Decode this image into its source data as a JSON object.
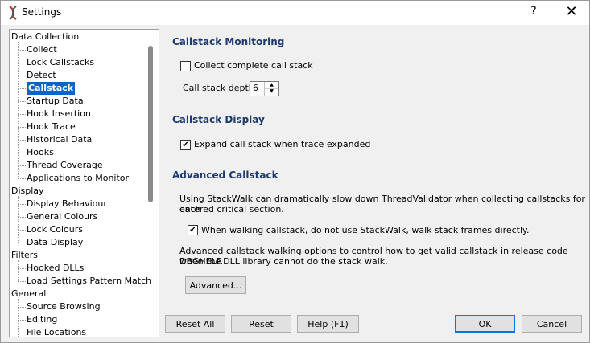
{
  "window": {
    "title": "Settings",
    "help_glyph": "?",
    "close_glyph": "✕"
  },
  "tree": {
    "items": [
      {
        "label": "Data Collection",
        "level": 0
      },
      {
        "label": "Collect",
        "level": 1
      },
      {
        "label": "Lock Callstacks",
        "level": 1
      },
      {
        "label": "Detect",
        "level": 1
      },
      {
        "label": "Callstack",
        "level": 1,
        "selected": true
      },
      {
        "label": "Startup Data",
        "level": 1
      },
      {
        "label": "Hook Insertion",
        "level": 1
      },
      {
        "label": "Hook Trace",
        "level": 1
      },
      {
        "label": "Historical Data",
        "level": 1
      },
      {
        "label": "Hooks",
        "level": 1
      },
      {
        "label": "Thread Coverage",
        "level": 1
      },
      {
        "label": "Applications to Monitor",
        "level": 1
      },
      {
        "label": "Display",
        "level": 0
      },
      {
        "label": "Display Behaviour",
        "level": 1
      },
      {
        "label": "General Colours",
        "level": 1
      },
      {
        "label": "Lock Colours",
        "level": 1
      },
      {
        "label": "Data Display",
        "level": 1
      },
      {
        "label": "Filters",
        "level": 0
      },
      {
        "label": "Hooked DLLs",
        "level": 1
      },
      {
        "label": "Load Settings Pattern Match",
        "level": 1
      },
      {
        "label": "General",
        "level": 0
      },
      {
        "label": "Source Browsing",
        "level": 1
      },
      {
        "label": "Editing",
        "level": 1
      },
      {
        "label": "File Locations",
        "level": 1
      }
    ]
  },
  "monitoring": {
    "heading": "Callstack Monitoring",
    "collect_complete_label": "Collect complete call stack",
    "collect_complete_checked": false,
    "depth_label": "Call stack depth",
    "depth_value": "6"
  },
  "display": {
    "heading": "Callstack Display",
    "expand_label": "Expand call stack when trace expanded",
    "expand_checked": true
  },
  "advanced": {
    "heading": "Advanced Callstack",
    "desc1_line1": "Using StackWalk can dramatically slow down ThreadValidator when collecting callstacks for each",
    "desc1_line2": "entered critical section.",
    "stackwalk_label": "When walking callstack, do not use StackWalk, walk stack frames directly.",
    "stackwalk_checked": true,
    "desc2_line1": "Advanced callstack walking options to control how to get valid callstack in release code when the",
    "desc2_line2": "DBGHELP.DLL library cannot do the stack walk.",
    "advanced_button": "Advanced..."
  },
  "footer": {
    "reset_all": "Reset All",
    "reset": "Reset",
    "help": "Help (F1)",
    "ok": "OK",
    "cancel": "Cancel"
  },
  "check_glyph": "✔"
}
